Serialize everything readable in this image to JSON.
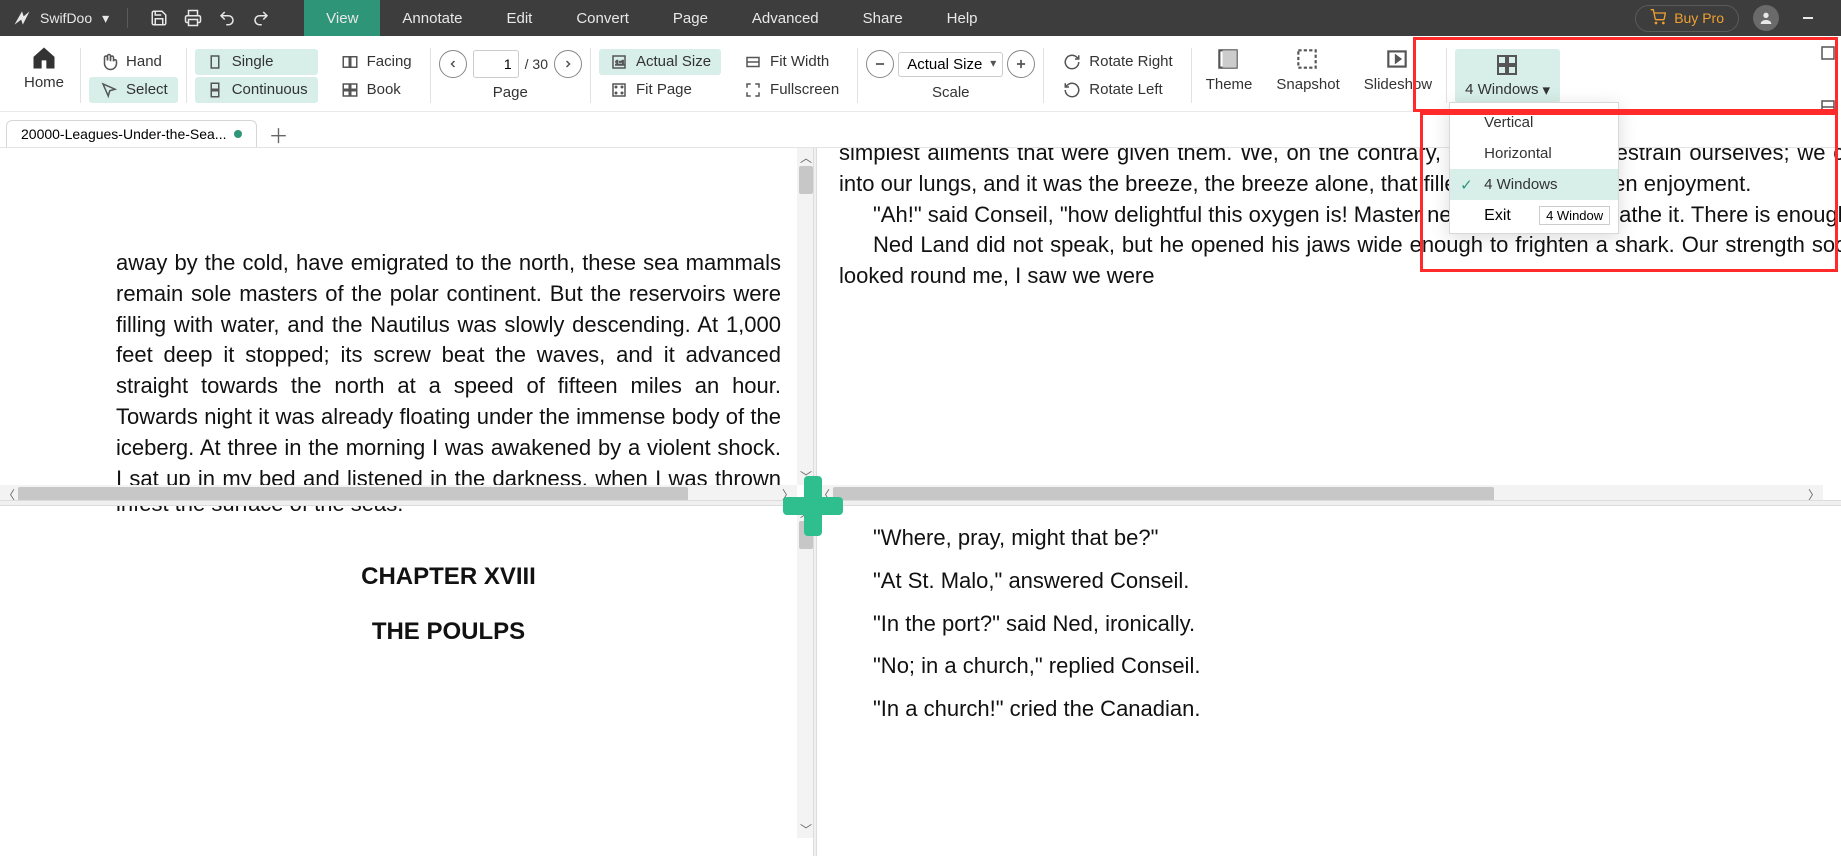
{
  "app": {
    "name": "SwifDoo"
  },
  "menu": {
    "view": "View",
    "annotate": "Annotate",
    "edit": "Edit",
    "convert": "Convert",
    "page": "Page",
    "advanced": "Advanced",
    "share": "Share",
    "help": "Help"
  },
  "titlebar": {
    "buy_pro": "Buy Pro"
  },
  "ribbon": {
    "home": "Home",
    "hand": "Hand",
    "select": "Select",
    "single": "Single",
    "continuous": "Continuous",
    "facing": "Facing",
    "book": "Book",
    "page_current": "1",
    "page_total": "/ 30",
    "page_label": "Page",
    "actual_size": "Actual Size",
    "fit_page": "Fit Page",
    "fit_width": "Fit Width",
    "fullscreen": "Fullscreen",
    "scale_value": "Actual Size",
    "scale_label": "Scale",
    "rotate_right": "Rotate Right",
    "rotate_left": "Rotate Left",
    "theme": "Theme",
    "snapshot": "Snapshot",
    "slideshow": "Slideshow",
    "windows_label": "4 Windows",
    "windows_menu": {
      "vertical": "Vertical",
      "horizontal": "Horizontal",
      "four": "4 Windows",
      "exit": "Exit",
      "exit_tag": "4 Window"
    }
  },
  "tab": {
    "name": "20000-Leagues-Under-the-Sea..."
  },
  "content": {
    "pane1_p1": "away by the cold, have emigrated to the north, these sea mammals remain sole masters of the polar continent. But the reservoirs were filling with water, and the Nautilus was slowly descending. At 1,000 feet deep it stopped; its screw beat the waves, and it advanced straight towards the north at a speed of fifteen miles an hour. Towards night it was already floating under the immense body of the iceberg. At three in the morning I was awakened by a violent shock. I sat up in my bed and listened in the darkness, when I was thrown into the middle of the room. The Nautilus, after having struck, had rebounded violently. I groped along the partition, and by the staircase to the saloon, which was lit by the luminous ceiling. The furniture was upset. Fortunately the windows were firmly set, and",
    "pane2_p1": "simplest aliments that were given them. We, on the contrary, had no need to restrain ourselves; we could draw this air freely into our lungs, and it was the breeze, the breeze alone, that filled us with this keen enjoyment.",
    "pane2_p2": "\"Ah!\" said Conseil, \"how delightful this oxygen is! Master need not fear to breathe it. There is enough for everybody.\"",
    "pane2_p3": "Ned Land did not speak, but he opened his jaws wide enough to frighten a shark. Our strength soon returned, and, when I looked round me, I saw we were",
    "pane3_top": "infest the surface of the seas.",
    "pane3_ch": "CHAPTER XVIII",
    "pane3_title": "THE POULPS",
    "pane4_l1": "\"Where, pray, might that be?\"",
    "pane4_l2": "\"At St. Malo,\" answered Conseil.",
    "pane4_l3": "\"In the port?\" said Ned, ironically.",
    "pane4_l4": "\"No; in a church,\" replied Conseil.",
    "pane4_l5": "\"In a church!\" cried the Canadian."
  }
}
